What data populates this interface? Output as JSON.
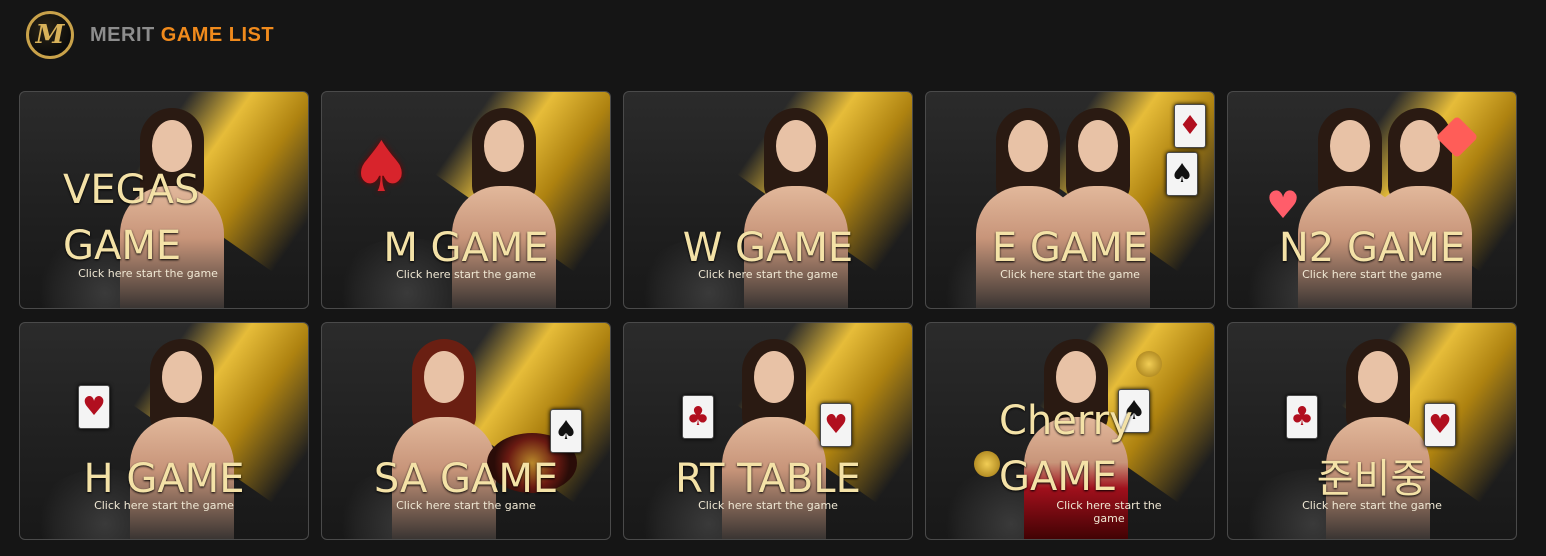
{
  "header": {
    "brand_word1": "MERIT",
    "brand_word2": "GAME LIST",
    "logo_letter": "M"
  },
  "games": [
    {
      "title": "VEGAS GAME",
      "subtitle": "Click here start the game"
    },
    {
      "title": "M GAME",
      "subtitle": "Click here start the game"
    },
    {
      "title": "W GAME",
      "subtitle": "Click here start the game"
    },
    {
      "title": "E GAME",
      "subtitle": "Click here start the game"
    },
    {
      "title": "N2 GAME",
      "subtitle": "Click here start the game"
    },
    {
      "title": "H GAME",
      "subtitle": "Click here start the game"
    },
    {
      "title": "SA GAME",
      "subtitle": "Click here start the game"
    },
    {
      "title": "RT TABLE",
      "subtitle": "Click here start the game"
    },
    {
      "title": "Cherry GAME",
      "subtitle": "Click here start the game"
    },
    {
      "title": "준비중",
      "subtitle": "Click here start the game"
    }
  ],
  "colors": {
    "accent": "#f08a1c",
    "title_text": "#f4e2a7",
    "gold": "#f0c43a"
  }
}
